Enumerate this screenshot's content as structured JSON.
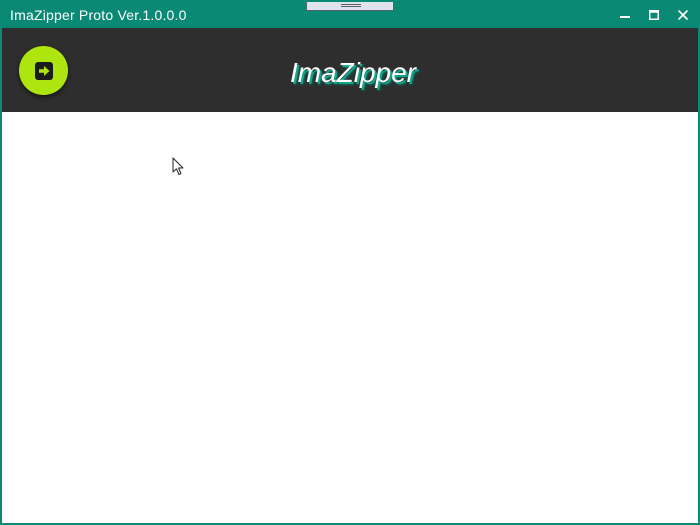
{
  "window": {
    "title": "ImaZipper Proto Ver.1.0.0.0",
    "controls": {
      "minimize": "minimize",
      "maximize": "maximize",
      "close": "close"
    }
  },
  "header": {
    "app_title": "ImaZipper",
    "action_button_icon": "arrow-right-icon"
  },
  "colors": {
    "titlebar": "#0a8a74",
    "header_background": "#2e2e2e",
    "action_button": "#aee50f",
    "title_shadow": "#14a58c",
    "content_background": "#ffffff"
  }
}
